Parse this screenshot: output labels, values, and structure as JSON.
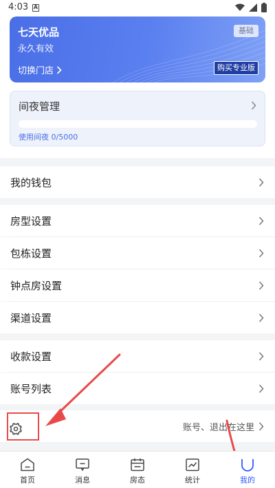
{
  "status_bar": {
    "time": "4:03",
    "notif_letter": "A"
  },
  "member_card": {
    "store_name": "七天优品",
    "validity": "永久有效",
    "switch_store": "切换门店",
    "plan_badge": "基础",
    "upgrade_button": "购买专业版"
  },
  "night_management": {
    "title": "间夜管理",
    "usage_text": "使用间夜 0/5000",
    "used": 0,
    "total": 5000
  },
  "menu": {
    "wallet": "我的钱包",
    "room_type": "房型设置",
    "package": "包栋设置",
    "hourly_room": "钟点房设置",
    "channel": "渠道设置",
    "payment": "收款设置",
    "account_list": "账号列表"
  },
  "settings_row": {
    "hint": "账号、退出在这里"
  },
  "tabbar": {
    "tabs": [
      {
        "label": "首页",
        "icon": "home-icon"
      },
      {
        "label": "消息",
        "icon": "message-icon"
      },
      {
        "label": "房态",
        "icon": "calendar-icon"
      },
      {
        "label": "统计",
        "icon": "chart-icon"
      },
      {
        "label": "我的",
        "icon": "profile-icon",
        "active": true
      }
    ]
  },
  "colors": {
    "brand_blue": "#4a6ee6",
    "active_tab": "#2e5bff",
    "annotation_red": "#e84a4a"
  }
}
